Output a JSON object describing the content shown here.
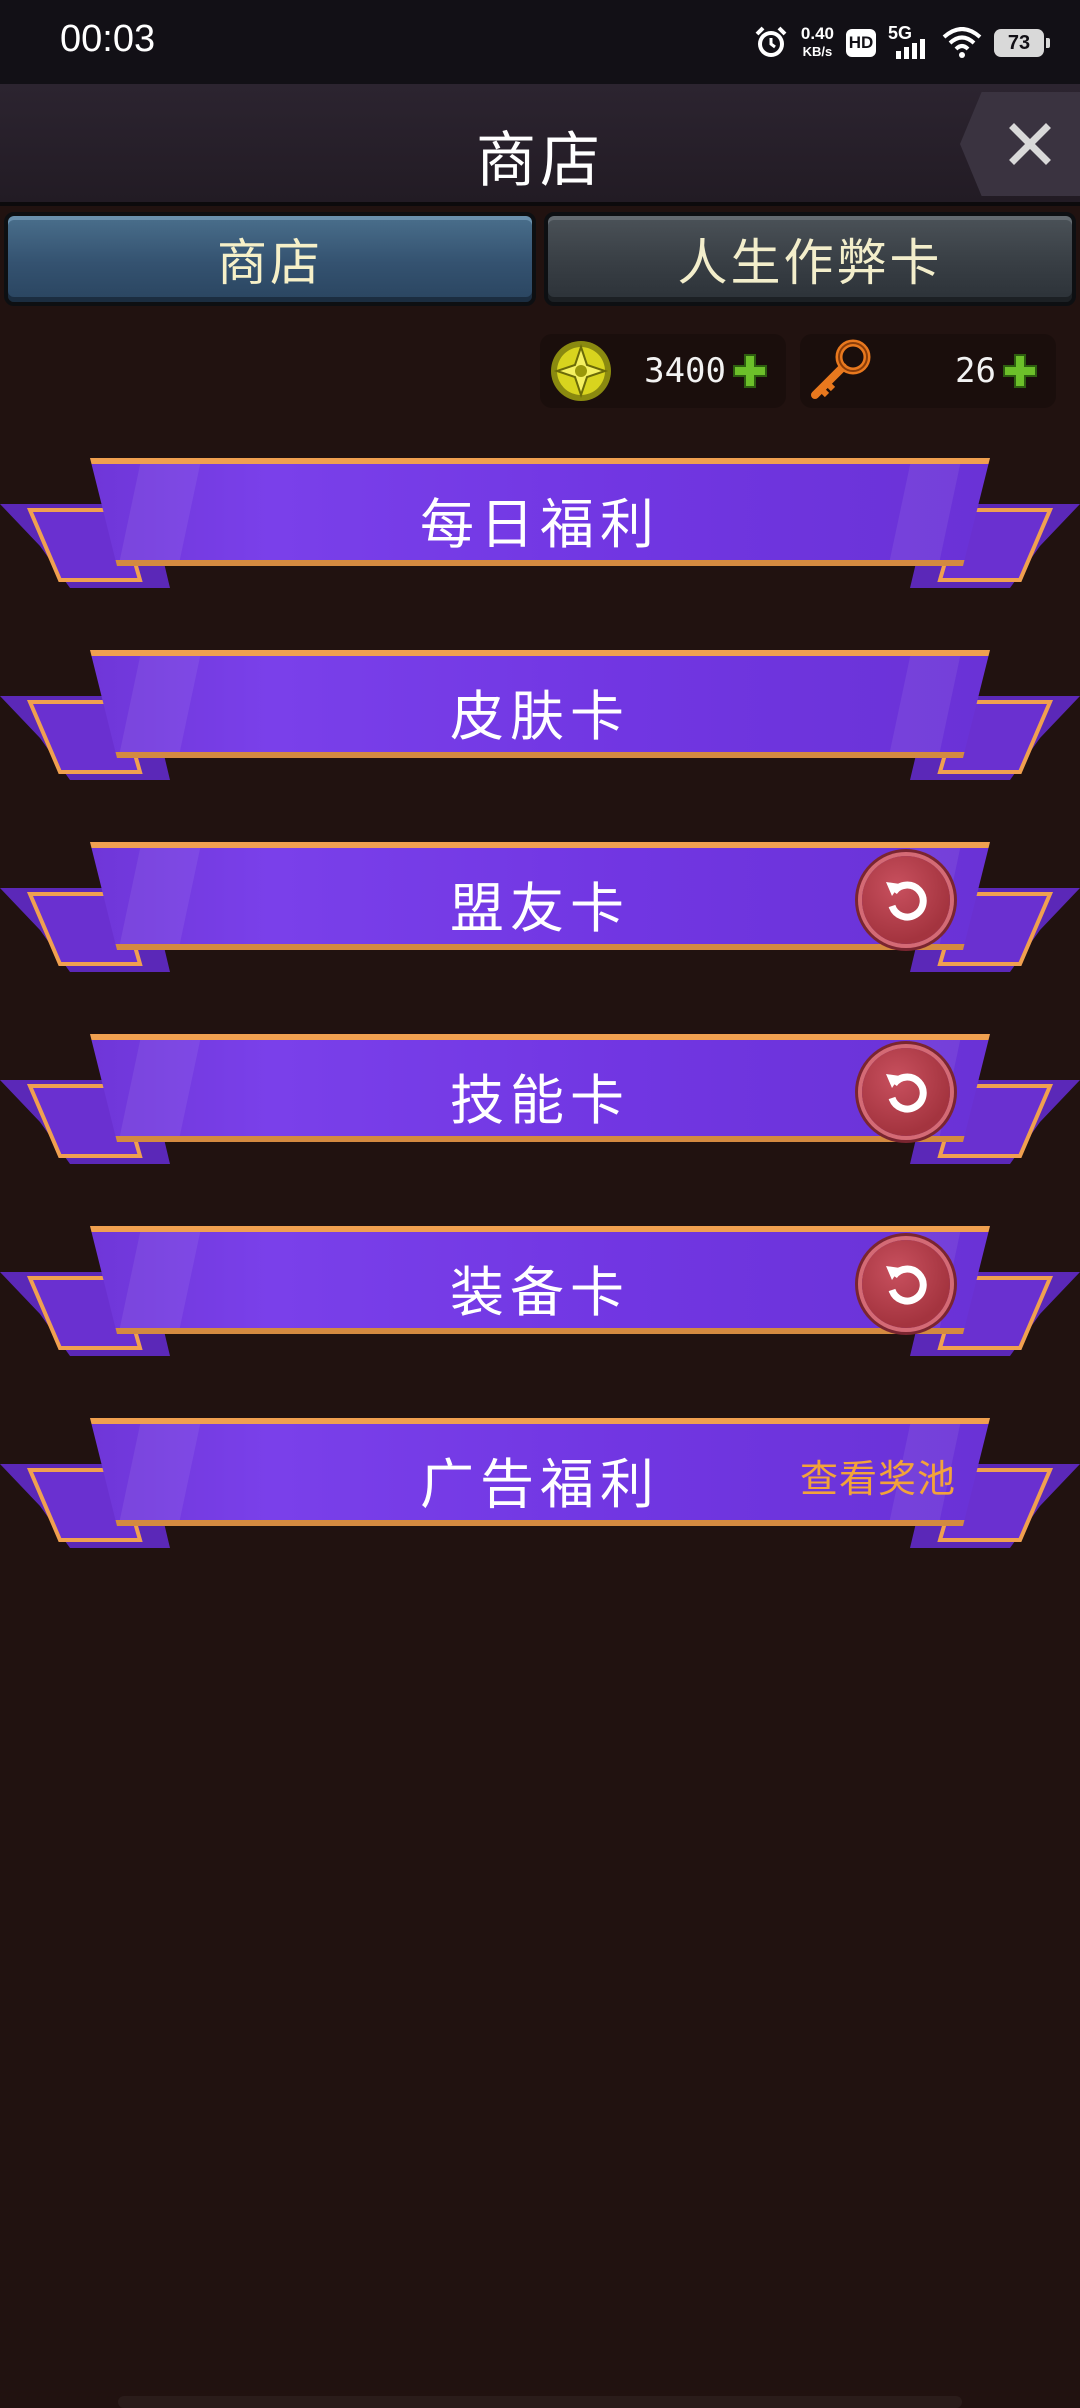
{
  "status_bar": {
    "time": "00:03",
    "speed_value": "0.40",
    "speed_unit": "KB/s",
    "hd_label": "HD",
    "network_label": "5G",
    "battery": "73"
  },
  "header": {
    "title": "商店"
  },
  "tabs": [
    {
      "label": "商店",
      "active": true
    },
    {
      "label": "人生作弊卡",
      "active": false
    }
  ],
  "currency": {
    "gems": "3400",
    "keys": "26"
  },
  "banners": [
    {
      "label": "每日福利"
    },
    {
      "label": "皮肤卡"
    },
    {
      "label": "盟友卡"
    },
    {
      "label": "技能卡"
    },
    {
      "label": "装备卡"
    },
    {
      "label": "广告福利",
      "link": "查看奖池"
    }
  ],
  "colors": {
    "background": "#211210",
    "ribbon": "#7136e2",
    "ribbon_border": "#f0a050",
    "link": "#f3a33a"
  }
}
